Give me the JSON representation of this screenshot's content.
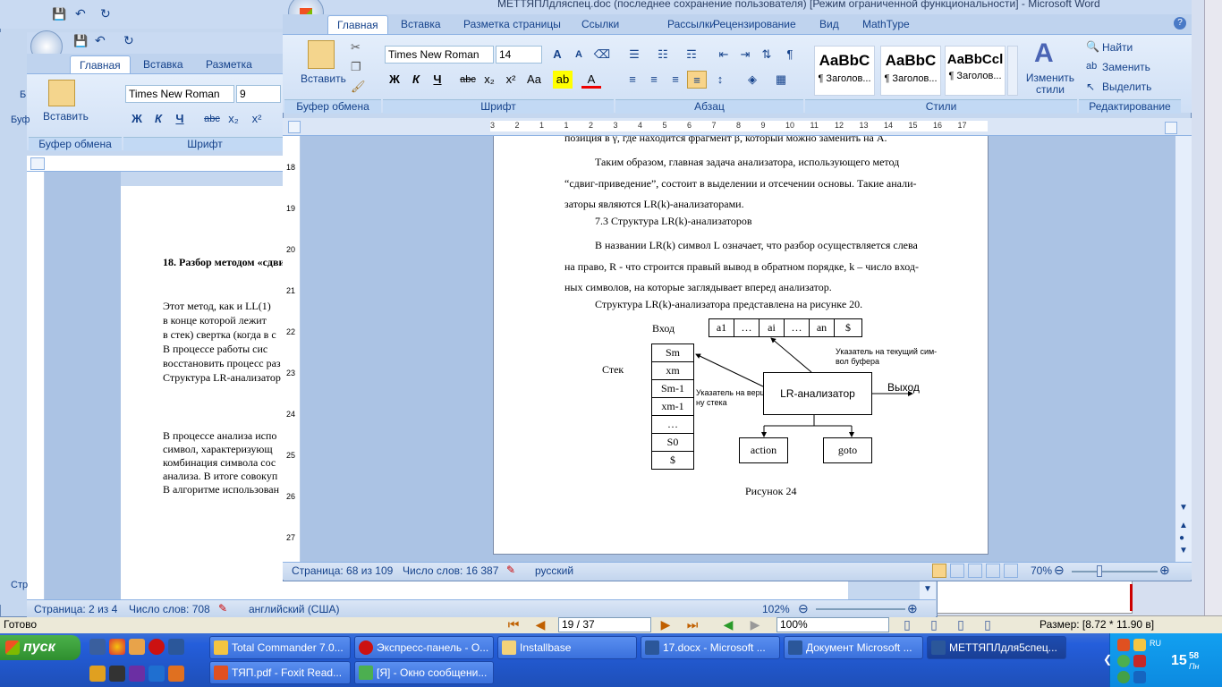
{
  "foxit": {
    "status_left": "Готово",
    "page_input": "19 / 37",
    "zoom": "100%",
    "size_text": "Размер: [8.72 * 11.90 в]"
  },
  "back_window": {
    "tabs": [
      "Главная",
      "Вставка",
      "Разметка страни"
    ],
    "font_name": "Times New Roman",
    "font_size": "9",
    "paste_label": "Вставить",
    "clipboard_group": "Буфер обмена",
    "font_group": "Шрифт",
    "heading": "18. Разбор методом «сдви",
    "para1": [
      "Этот метод, как и LL(1)",
      "в конце которой лежит",
      "в стек) свертка (когда в с",
      "В процессе работы сис",
      "восстановить процесс раз",
      "Структура LR-анализатор"
    ],
    "para2": [
      "В процессе анализа испо",
      "символ, характеризующ",
      "комбинация символа сос",
      "анализа. В итоге совокуп",
      "В алгоритме использован"
    ],
    "status_page": "Страница: 2 из 4",
    "status_words": "Число слов: 708",
    "status_lang": "английский (США)",
    "zoom": "102%",
    "left_edge_labels": [
      "Б",
      "Буф",
      "Стр"
    ]
  },
  "front_window": {
    "title": "МЕТТЯПЛдляспец.doc (последнее сохранение пользователя) [Режим ограниченной функциональности] - Microsoft Word",
    "tabs": [
      "Главная",
      "Вставка",
      "Разметка страницы",
      "Ссылки",
      "Рассылки",
      "Рецензирование",
      "Вид",
      "MathType"
    ],
    "paste_label": "Вставить",
    "font_name": "Times New Roman",
    "font_size": "14",
    "styles": [
      {
        "sample": "AaBbC",
        "name": "¶ Заголов..."
      },
      {
        "sample": "AaBbC",
        "name": "¶ Заголов..."
      },
      {
        "sample": "AaBbCcl",
        "name": "¶ Заголов..."
      }
    ],
    "change_styles": "Изменить стили",
    "find": "Найти",
    "replace": "Заменить",
    "select": "Выделить",
    "groups": {
      "clipboard": "Буфер обмена",
      "font": "Шрифт",
      "paragraph": "Абзац",
      "styles": "Стили",
      "editing": "Редактирование"
    },
    "ruler_marks": [
      "3",
      "2",
      "1",
      "1",
      "2",
      "3",
      "4",
      "5",
      "6",
      "7",
      "8",
      "9",
      "10",
      "11",
      "12",
      "13",
      "14",
      "15",
      "16",
      "17"
    ],
    "vruler_marks": [
      "18",
      "19",
      "20",
      "21",
      "22",
      "23",
      "24",
      "25",
      "26",
      "27"
    ],
    "doc": {
      "line0": "позиция в γ, где находится фрагмент β, который можно заменить на A.",
      "p1": [
        "Таким образом, главная задача анализатора, использующего метод",
        "“сдвиг-приведение”, состоит в выделении и отсечении основы. Такие анали-",
        "заторы являются LR(k)-анализаторами."
      ],
      "heading": "7.3 Структура LR(k)-анализаторов",
      "p2": [
        "В названии LR(k) символ L означает, что разбор осуществляется слева",
        "на право, R - что строится правый вывод в обратном порядке, k – число вход-",
        "ных символов, на которые заглядывает вперед анализатор."
      ],
      "p3": "Структура LR(k)-анализатора представлена на рисунке 20.",
      "figure": {
        "input_label": "Вход",
        "input_cells": [
          "a1",
          "…",
          "ai",
          "…",
          "an",
          "$"
        ],
        "stack_label": "Стек",
        "stack_cells": [
          "Sm",
          "xm",
          "Sm-1",
          "xm-1",
          "…",
          "S0",
          "$"
        ],
        "ptr_buffer": [
          "Указатель на текущий сим-",
          "вол буфера"
        ],
        "ptr_stack": [
          "Указатель на верши-",
          "ну стека"
        ],
        "analyzer": "LR-анализатор",
        "output": "Выход",
        "action": "action",
        "goto": "goto",
        "caption": "Рисунок 24"
      }
    },
    "status_page": "Страница: 68 из 109",
    "status_words": "Число слов: 16 387",
    "status_lang": "русский",
    "zoom": "70%"
  },
  "taskbar": {
    "start": "пуск",
    "row1": [
      "Total Commander 7.0...",
      "Экспресс-панель - О...",
      "Installbase",
      "17.docx - Microsoft ...",
      "Документ Microsoft ...",
      "МЕТТЯПЛдля5спец..."
    ],
    "row2": [
      "ТЯП.pdf - Foxit Read...",
      "[Я] - Окно сообщени..."
    ],
    "time": "15",
    "time_min": "58",
    "day": "Пн",
    "lang": "RU"
  }
}
